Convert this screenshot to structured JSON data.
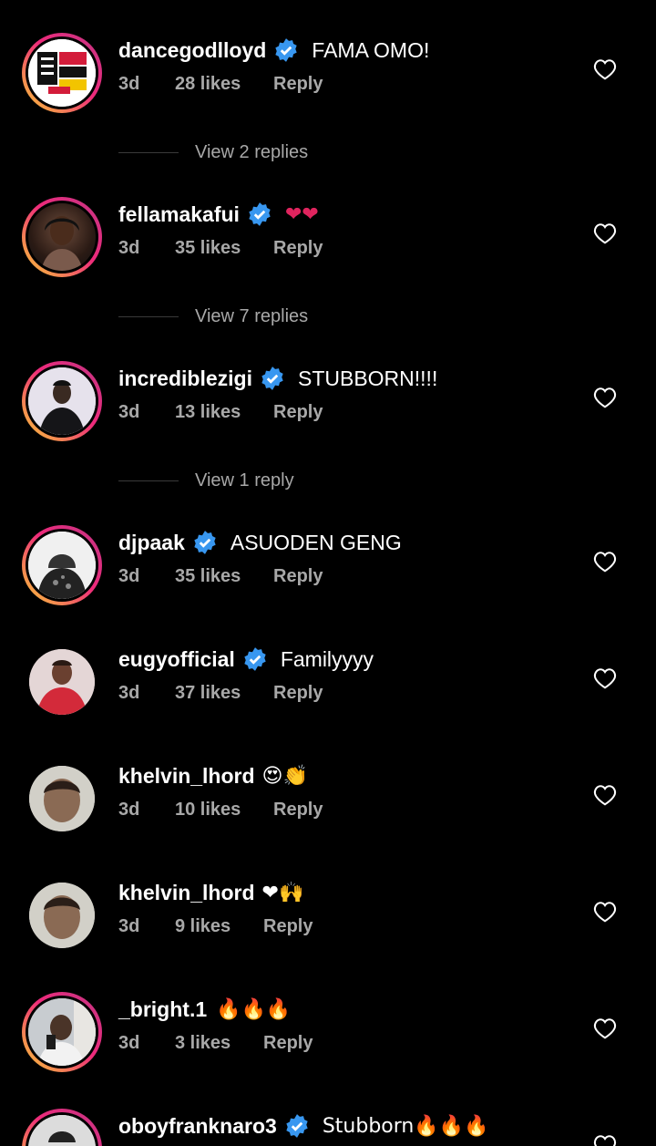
{
  "comments": [
    {
      "username": "dancegodlloyd",
      "verified": true,
      "text": "FAMA OMO!",
      "age": "3d",
      "likes": "28 likes",
      "reply": "Reply",
      "replies_label": "View 2 replies"
    },
    {
      "username": "fellamakafui",
      "verified": true,
      "text": "❤❤",
      "age": "3d",
      "likes": "35 likes",
      "reply": "Reply",
      "replies_label": "View 7 replies"
    },
    {
      "username": "incrediblezigi",
      "verified": true,
      "text": "STUBBORN!!!!",
      "age": "3d",
      "likes": "13 likes",
      "reply": "Reply",
      "replies_label": "View 1 reply"
    },
    {
      "username": "djpaak",
      "verified": true,
      "text": "ASUODEN GENG",
      "age": "3d",
      "likes": "35 likes",
      "reply": "Reply"
    },
    {
      "username": "eugyofficial",
      "verified": true,
      "text": "Familyyyy",
      "age": "3d",
      "likes": "37 likes",
      "reply": "Reply"
    },
    {
      "username": "khelvin_lhord",
      "verified": false,
      "text": "😍👏",
      "age": "3d",
      "likes": "10 likes",
      "reply": "Reply"
    },
    {
      "username": "khelvin_lhord",
      "verified": false,
      "text": "❤🙌",
      "age": "3d",
      "likes": "9 likes",
      "reply": "Reply"
    },
    {
      "username": "_bright.1",
      "verified": false,
      "text": "🔥🔥🔥",
      "age": "3d",
      "likes": "3 likes",
      "reply": "Reply"
    },
    {
      "username": "oboyfranknaro3",
      "verified": true,
      "text": "Stubborn🔥🔥🔥"
    }
  ],
  "colors": {
    "background": "#000000",
    "verified": "#3897f0",
    "secondary_text": "#a8a8a8",
    "heart_red": "#e0245e"
  },
  "icons": {
    "like": "heart-outline-icon",
    "verified": "verified-badge-icon"
  }
}
